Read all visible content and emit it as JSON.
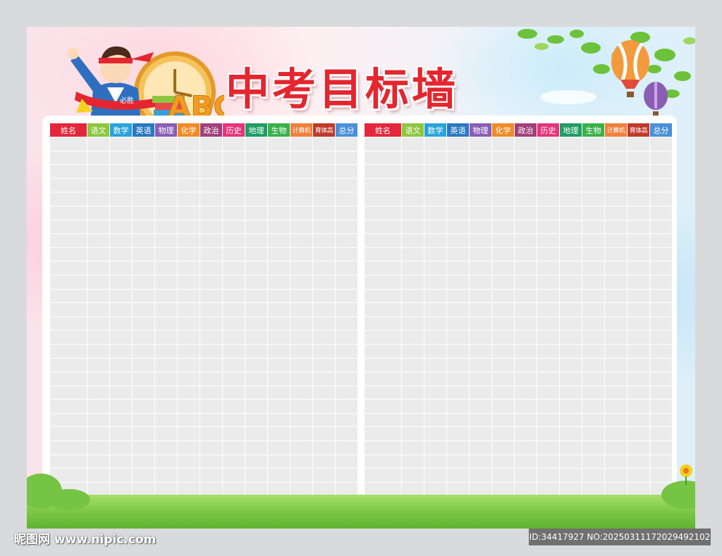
{
  "title": "中考目标墙",
  "decoration": {
    "banner_text": "必胜",
    "letters": "ABC"
  },
  "table": {
    "headers": [
      "姓名",
      "语文",
      "数学",
      "英语",
      "物理",
      "化学",
      "政治",
      "历史",
      "地理",
      "生物",
      "计算机",
      "育体高",
      "总分"
    ],
    "header_colors": [
      "#e4273b",
      "#8dc63f",
      "#29a3dc",
      "#2a78c2",
      "#8a5eb4",
      "#f08a24",
      "#a0407c",
      "#e6337a",
      "#1f9d63",
      "#39b04a",
      "#f0803c",
      "#c0392b",
      "#4a90d9"
    ],
    "row_count": 27
  },
  "footer": {
    "watermark": "昵图网 www.nipic.com",
    "id_text": "ID:34417927 NO:20250311172029492102"
  }
}
